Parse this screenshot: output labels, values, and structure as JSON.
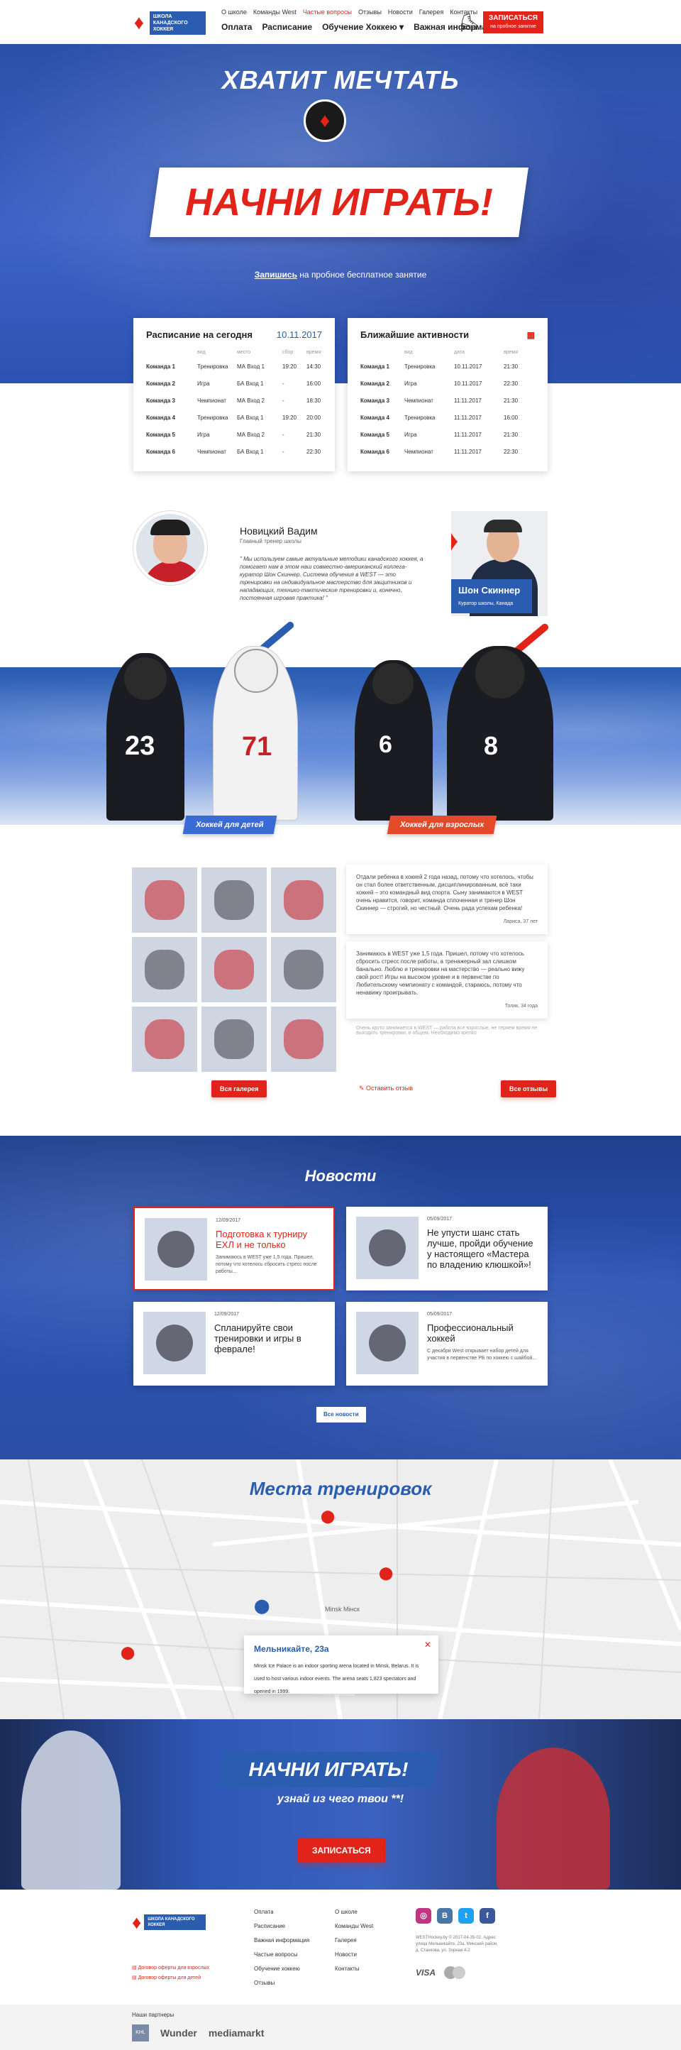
{
  "header": {
    "logo_text": "ШКОЛА КАНАДСКОГО ХОККЕЯ",
    "top_nav": [
      {
        "label": "О школе"
      },
      {
        "label": "Команды West"
      },
      {
        "label": "Частые вопросы"
      },
      {
        "label": "Отзывы"
      },
      {
        "label": "Новости"
      },
      {
        "label": "Галерея"
      },
      {
        "label": "Контакты"
      }
    ],
    "main_nav": [
      {
        "label": "Оплата"
      },
      {
        "label": "Расписание"
      },
      {
        "label": "Обучение Хоккею ▾"
      },
      {
        "label": "Важная информация ▾"
      }
    ],
    "signup_title": "ЗАПИСАТЬСЯ",
    "signup_sub": "на пробное занятие"
  },
  "hero": {
    "headline": "ХВАТИТ МЕЧТАТЬ",
    "banner": "НАЧНИ ИГРАТЬ!",
    "link_text": "Запишись",
    "link_rest": " на пробное бесплатное занятие"
  },
  "schedule": {
    "title": "Расписание на сегодня",
    "date": "10.11.2017",
    "rows": [
      [
        "Команда 1",
        "Тренировка",
        "МА Вход 1",
        "19:20",
        "14:30"
      ],
      [
        "Команда 2",
        "Игра",
        "БА Вход 1",
        "-",
        "16:00"
      ],
      [
        "Команда 3",
        "Чемпионат",
        "МА Вход 2",
        "-",
        "18:30"
      ],
      [
        "Команда 4",
        "Тренировка",
        "БА Вход 1",
        "19:20",
        "20:00"
      ],
      [
        "Команда 5",
        "Игра",
        "МА Вход 2",
        "-",
        "21:30"
      ],
      [
        "Команда 6",
        "Чемпионат",
        "БА Вход 1",
        "-",
        "22:30"
      ]
    ]
  },
  "activities": {
    "title": "Ближайшие активности",
    "rows": [
      [
        "Команда 1",
        "Тренировка",
        "10.11.2017",
        "21:30"
      ],
      [
        "Команда 2",
        "Игра",
        "10.11.2017",
        "22:30"
      ],
      [
        "Команда 3",
        "Чемпионат",
        "11.11.2017",
        "21:30"
      ],
      [
        "Команда 4",
        "Тренировка",
        "11.11.2017",
        "16:00"
      ],
      [
        "Команда 5",
        "Игра",
        "11.11.2017",
        "21:30"
      ],
      [
        "Команда 6",
        "Чемпионат",
        "11.11.2017",
        "22:30"
      ]
    ]
  },
  "coach": {
    "name": "Новицкий Вадим",
    "role": "Главный тренер школы",
    "quote": "\" Мы используем самые актуальные методики канадского хоккея, а помогает нам в этом наш совместно-американский коллега-куратор Шон Скиннер. Система обучения в WEST — это тренировки на индивидуальное мастерство для защитников и нападающих, технико-тактические тренировки и, конечно, постоянная игровая практика! \"",
    "curator_name": "Шон Скиннер",
    "curator_role": "Куратор школы, Канада"
  },
  "programs": {
    "kids": "Хоккей для детей",
    "adults": "Хоккей для взрослых"
  },
  "players": {
    "p1": "23",
    "p2": "71",
    "p3": "6",
    "p4": "8"
  },
  "reviews": [
    {
      "text": "Отдали ребенка в хоккей 2 года назад, потому что хотелось, чтобы он стал более ответственным, дисциплинированным, всё таки хоккей – это командный вид спорта. Сыну занимаются в WEST очень нравится, говорит, команда сплоченная и тренер Шон Скиннер — строгий, но честный. Очень рада успехам ребенка!",
      "author": "Лариса, 37 лет"
    },
    {
      "text": "Занимаюсь в WEST уже 1,5 года. Пришел, потому что хотелось сбросить стресс после работы, а тренажерный зал слишком банально. Люблю и тренировки на мастерство — реально вижу свой рост! Игры на высоком уровне и в первенстве по Любительскому чемпионату с командой, стараюсь, потому что ненавижу проигрывать.",
      "author": "Толик, 34 года"
    }
  ],
  "reviews_fade": "Очень круто занимается в WEST — работа все взрослые, не теряем время не выходить тренировки, в общем. Необходимо крепко",
  "gallery_btn": "Вся галерея",
  "feedback_link": "Оставить отзыв",
  "all_reviews_btn": "Все отзывы",
  "news": {
    "title": "Новости",
    "items": [
      {
        "date": "12/09/2017",
        "title": "Подготовка к турниру ЕХЛ и не только",
        "text": "Занимаюсь в WEST уже 1,5 года. Пришел, потому что хотелось сбросить стресс после работы..."
      },
      {
        "date": "05/09/2017",
        "title": "Не упусти шанс стать лучше, пройди обучение у настоящего «Мастера по владению клюшкой»!",
        "text": ""
      },
      {
        "date": "12/09/2017",
        "title": "Спланируйте свои тренировки и игры в феврале!",
        "text": ""
      },
      {
        "date": "05/09/2017",
        "title": "Профессиональный хоккей",
        "text": "С декабря West открывает набор детей для участия в первенстве РБ по хоккею с шайбой..."
      }
    ],
    "all_btn": "Все новости"
  },
  "map": {
    "title": "Места тренировок",
    "city_label": "Minsk Мінск",
    "place_name": "Мельникайте, 23а",
    "place_desc": "Minsk Ice Palace is an indoor sporting arena located in Minsk, Belarus. It is used to host various indoor events. The arena seats 1,823 spectators and opened in 1999."
  },
  "cta": {
    "banner": "НАЧНИ ИГРАТЬ!",
    "sub": "узнай из чего твои **!",
    "btn": "ЗАПИСАТЬСЯ"
  },
  "footer": {
    "logo_text": "ШКОЛА КАНАДСКОГО ХОККЕЯ",
    "col1": [
      "Оплата",
      "Расписание",
      "Важная информация",
      "Частые вопросы",
      "Обучение хоккею",
      "Отзывы"
    ],
    "col2": [
      "О школе",
      "Команды West",
      "Галерея",
      "Новости",
      "Контакты"
    ],
    "doc1": "Договор оферты для взрослых",
    "doc2": "Договор оферты для детей",
    "copy": "WESTHockey.by © 2017-04-35-02. Адрес: улица Мельникайте, 23а. Минский район, д. Станкова, ул. Зорная 4-2",
    "pay_visa": "VISA"
  },
  "partners": {
    "title": "Наши партнеры",
    "p1": "KHL",
    "p2": "Wunder",
    "p3": "mediamarkt"
  },
  "colors": {
    "brand_blue": "#2a5db0",
    "brand_red": "#e2231a"
  }
}
